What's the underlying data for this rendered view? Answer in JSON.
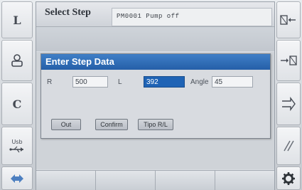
{
  "left_keys": [
    {
      "label": "L",
      "icon": "letter-l"
    },
    {
      "label": "",
      "icon": "user-profile-icon"
    },
    {
      "label": "C",
      "icon": "letter-c"
    },
    {
      "label": "Usb",
      "icon": "usb-icon"
    },
    {
      "label": "",
      "icon": "arrow-navigation-icon"
    }
  ],
  "right_keys": [
    {
      "label": "",
      "icon": "table-left-arrow-icon"
    },
    {
      "label": "",
      "icon": "arrow-right-to-table-icon"
    },
    {
      "label": "",
      "icon": "enter-arrow-icon"
    },
    {
      "label": "",
      "icon": "slash-lines-icon"
    },
    {
      "label": "",
      "icon": "gear-icon"
    }
  ],
  "screen": {
    "title": "Select Step",
    "status": "PM0001 Pump off"
  },
  "dialog": {
    "title": "Enter Step Data",
    "r_label": "R",
    "r_value": "500",
    "l_label": "L",
    "l_value": "392",
    "angle_label": "Angle",
    "angle_value": "45",
    "buttons": {
      "out": "Out",
      "confirm": "Confirm",
      "tipo": "Tipo R/L"
    }
  }
}
